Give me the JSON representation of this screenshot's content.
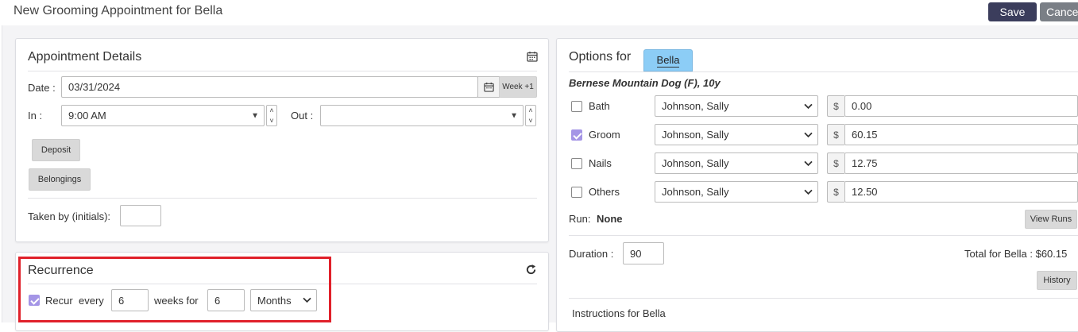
{
  "header": {
    "title": "New Grooming Appointment for Bella",
    "save_label": "Save",
    "cancel_label": "Cancel"
  },
  "appointment": {
    "title": "Appointment Details",
    "date_label": "Date :",
    "date_value": "03/31/2024",
    "week_button": "Week +1",
    "in_label": "In :",
    "in_value": "9:00 AM",
    "out_label": "Out :",
    "out_value": "",
    "deposit_label": "Deposit",
    "belongings_label": "Belongings",
    "taken_by_label": "Taken by (initials):",
    "taken_by_value": ""
  },
  "recurrence": {
    "title": "Recurrence",
    "recur_checked": true,
    "recur_label": "Recur",
    "every_label": "every",
    "every_value": "6",
    "weeks_for_label": "weeks for",
    "for_value": "6",
    "unit_value": "Months"
  },
  "options": {
    "title": "Options for",
    "pet_tab": "Bella",
    "breed": "Bernese Mountain Dog (F), 10y",
    "services": [
      {
        "name": "Bath",
        "checked": false,
        "staff": "Johnson, Sally",
        "price": "0.00"
      },
      {
        "name": "Groom",
        "checked": true,
        "staff": "Johnson, Sally",
        "price": "60.15"
      },
      {
        "name": "Nails",
        "checked": false,
        "staff": "Johnson, Sally",
        "price": "12.75"
      },
      {
        "name": "Others",
        "checked": false,
        "staff": "Johnson, Sally",
        "price": "12.50"
      }
    ],
    "currency_symbol": "$",
    "run_label": "Run:",
    "run_value": "None",
    "view_runs_label": "View Runs",
    "duration_label": "Duration :",
    "duration_value": "90",
    "total_label": "Total for Bella : $60.15",
    "history_label": "History",
    "instructions_label": "Instructions for Bella"
  },
  "colors": {
    "accent_purple": "#a495e6",
    "save_button": "#3b3d5c",
    "cancel_button": "#7a7f86",
    "pet_tab": "#8ccdf6",
    "highlight_border": "#e0202a"
  },
  "icons": {
    "calendar": "calendar-icon",
    "refresh": "refresh-icon",
    "dropdown": "chevron-down-icon"
  }
}
